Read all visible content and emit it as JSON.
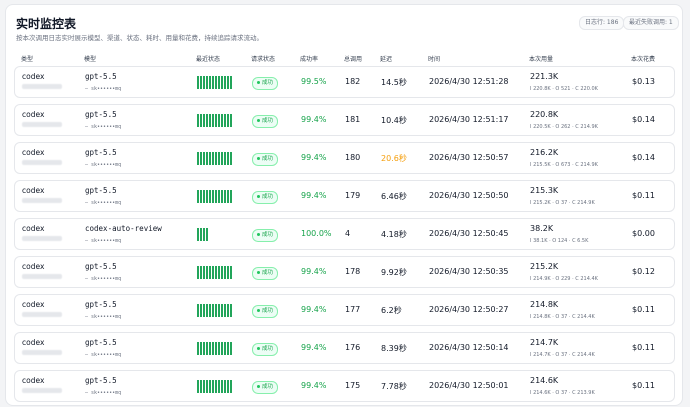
{
  "page": {
    "title": "实时监控表",
    "subtitle": "按本次调用日志实时展示模型、渠道、状态、耗时、用量和花费，持续追踪请求流动。"
  },
  "chips": {
    "today": "日志行: 186",
    "recent_fail": "最近失败调用: 1"
  },
  "columns": {
    "type": "类型",
    "model": "模型",
    "recent_status": "最近状态",
    "request_status": "请求状态",
    "success_rate": "成功率",
    "total_calls": "总调用",
    "latency": "延迟",
    "time": "时间",
    "usage": "本次用量",
    "cost": "本次花费"
  },
  "status_color": "#22a55a",
  "rows": [
    {
      "type": "codex",
      "model": "gpt-5.5",
      "key": "— sk••••••mq",
      "bars": 12,
      "status": "成功",
      "rate": "99.5%",
      "total": "182",
      "latency": "14.5秒",
      "latency_slow": false,
      "time": "2026/4/30 12:51:28",
      "usage": "221.3K",
      "usage_detail": "I 220.8K · O 521 · C 220.0K",
      "cost": "$0.13"
    },
    {
      "type": "codex",
      "model": "gpt-5.5",
      "key": "— sk••••••mq",
      "bars": 12,
      "status": "成功",
      "rate": "99.4%",
      "total": "181",
      "latency": "10.4秒",
      "latency_slow": false,
      "time": "2026/4/30 12:51:17",
      "usage": "220.8K",
      "usage_detail": "I 220.5K · O 262 · C 214.9K",
      "cost": "$0.14"
    },
    {
      "type": "codex",
      "model": "gpt-5.5",
      "key": "— sk••••••mq",
      "bars": 12,
      "status": "成功",
      "rate": "99.4%",
      "total": "180",
      "latency": "20.6秒",
      "latency_slow": true,
      "time": "2026/4/30 12:50:57",
      "usage": "216.2K",
      "usage_detail": "I 215.5K · O 673 · C 214.9K",
      "cost": "$0.14"
    },
    {
      "type": "codex",
      "model": "gpt-5.5",
      "key": "— sk••••••mq",
      "bars": 12,
      "status": "成功",
      "rate": "99.4%",
      "total": "179",
      "latency": "6.46秒",
      "latency_slow": false,
      "time": "2026/4/30 12:50:50",
      "usage": "215.3K",
      "usage_detail": "I 215.2K · O 37 · C 214.9K",
      "cost": "$0.11"
    },
    {
      "type": "codex",
      "model": "codex-auto-review",
      "key": "— sk••••••mq",
      "bars": 4,
      "status": "成功",
      "rate": "100.0%",
      "total": "4",
      "latency": "4.18秒",
      "latency_slow": false,
      "time": "2026/4/30 12:50:45",
      "usage": "38.2K",
      "usage_detail": "I 38.1K · O 124 · C 6.5K",
      "cost": "$0.00"
    },
    {
      "type": "codex",
      "model": "gpt-5.5",
      "key": "— sk••••••mq",
      "bars": 12,
      "status": "成功",
      "rate": "99.4%",
      "total": "178",
      "latency": "9.92秒",
      "latency_slow": false,
      "time": "2026/4/30 12:50:35",
      "usage": "215.2K",
      "usage_detail": "I 214.9K · O 229 · C 214.4K",
      "cost": "$0.12"
    },
    {
      "type": "codex",
      "model": "gpt-5.5",
      "key": "— sk••••••mq",
      "bars": 12,
      "status": "成功",
      "rate": "99.4%",
      "total": "177",
      "latency": "6.2秒",
      "latency_slow": false,
      "time": "2026/4/30 12:50:27",
      "usage": "214.8K",
      "usage_detail": "I 214.8K · O 37 · C 214.4K",
      "cost": "$0.11"
    },
    {
      "type": "codex",
      "model": "gpt-5.5",
      "key": "— sk••••••mq",
      "bars": 12,
      "status": "成功",
      "rate": "99.4%",
      "total": "176",
      "latency": "8.39秒",
      "latency_slow": false,
      "time": "2026/4/30 12:50:14",
      "usage": "214.7K",
      "usage_detail": "I 214.7K · O 37 · C 214.4K",
      "cost": "$0.11"
    },
    {
      "type": "codex",
      "model": "gpt-5.5",
      "key": "— sk••••••mq",
      "bars": 12,
      "status": "成功",
      "rate": "99.4%",
      "total": "175",
      "latency": "7.78秒",
      "latency_slow": false,
      "time": "2026/4/30 12:50:01",
      "usage": "214.6K",
      "usage_detail": "I 214.6K · O 37 · C 213.9K",
      "cost": "$0.11"
    }
  ]
}
